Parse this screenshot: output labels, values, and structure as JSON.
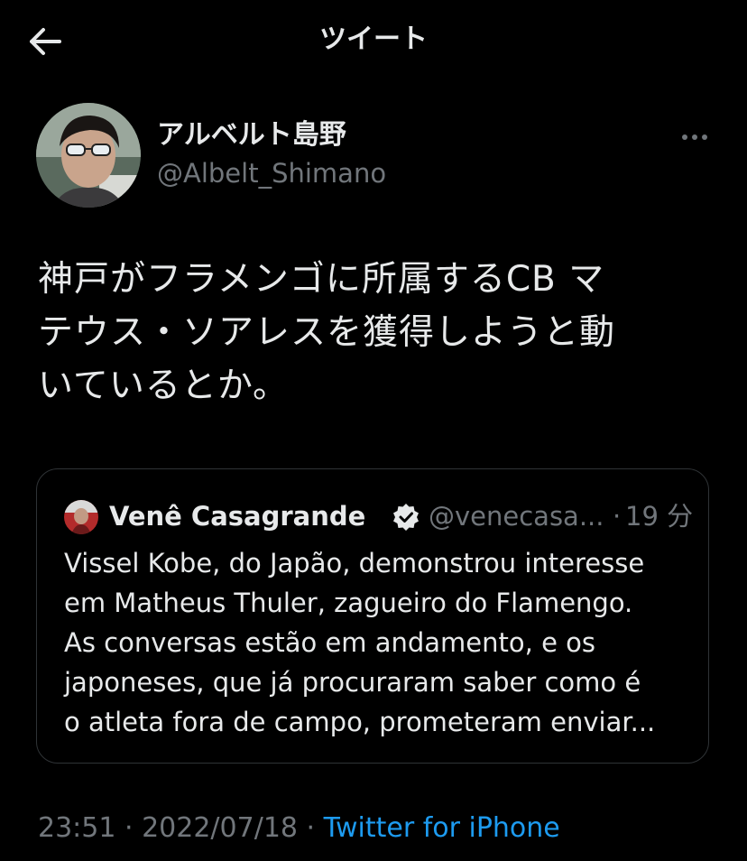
{
  "header": {
    "title": "ツイート",
    "back_icon": "arrow-left-icon"
  },
  "author": {
    "display_name": "アルベルト島野",
    "handle": "@Albelt_Shimano",
    "more_icon": "more-horizontal-icon"
  },
  "tweet": {
    "lines": [
      "神戸がフラメンゴに所属するCB マ",
      "テウス・ソアレスを獲得しようと動",
      "いているとか。"
    ]
  },
  "quoted_tweet": {
    "display_name": "Venê Casagrande",
    "verified_icon": "verified-badge-icon",
    "handle": "@venecasa...",
    "separator": "·",
    "time": "19 分",
    "lines": [
      "Vissel Kobe, do Japão, demonstrou interesse",
      "em Matheus Thuler, zagueiro do Flamengo.",
      "As conversas estão em andamento, e os",
      "japoneses, que já procuraram saber como é",
      "o atleta fora de campo, prometeram enviar..."
    ]
  },
  "meta": {
    "time": "23:51",
    "separator1": " · ",
    "date": "2022/07/18",
    "separator2": " · ",
    "source": "Twitter for iPhone"
  },
  "colors": {
    "background": "#000000",
    "text_primary": "#e7e9ea",
    "text_secondary": "#71767b",
    "accent": "#1d9bf0",
    "border": "#2f3336"
  }
}
